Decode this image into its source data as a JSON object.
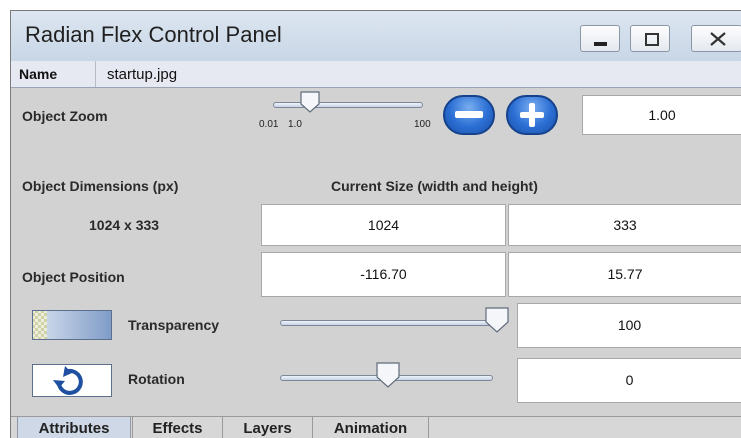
{
  "window": {
    "title": "Radian Flex Control Panel",
    "controls": {
      "minimize": "minimize",
      "maximize": "maximize",
      "close": "close"
    }
  },
  "name_row": {
    "label": "Name",
    "value": "startup.jpg"
  },
  "zoom": {
    "label": "Object Zoom",
    "tick_labels": [
      "0.01",
      "1.0",
      "100"
    ],
    "slider_value": 1.0,
    "value": "1.00"
  },
  "dimensions": {
    "label": "Object Dimensions (px)",
    "current_size_label": "Current Size (width and height)",
    "original": "1024 x 333",
    "width": "1024",
    "height": "333"
  },
  "position": {
    "label": "Object Position",
    "x": "-116.70",
    "y": "15.77"
  },
  "transparency": {
    "label": "Transparency",
    "value": "100",
    "slider_fraction": 1.0
  },
  "rotation": {
    "label": "Rotation",
    "value": "0",
    "slider_fraction": 0.5
  },
  "tabs": [
    {
      "label": "Attributes",
      "selected": true
    },
    {
      "label": "Effects",
      "selected": false
    },
    {
      "label": "Layers",
      "selected": false
    },
    {
      "label": "Animation",
      "selected": false
    }
  ],
  "icons": {
    "minimize": "minimize-icon",
    "maximize": "maximize-icon",
    "close": "close-icon",
    "zoom_out": "minus-icon",
    "zoom_in": "plus-icon",
    "transparency": "checkerboard-gradient-icon",
    "rotation": "rotate-arrow-icon"
  }
}
